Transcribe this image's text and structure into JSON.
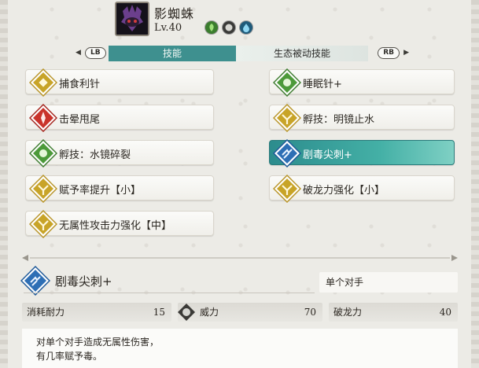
{
  "monster": {
    "name": "影蜘蛛",
    "level": "Lv.40",
    "elements": [
      "grass-element-icon",
      "neutral-element-icon",
      "water-element-icon"
    ]
  },
  "tabs": {
    "lb": "LB",
    "rb": "RB",
    "skills": "技能",
    "eco": "生态被动技能"
  },
  "skills": [
    {
      "label": "捕食利针",
      "icon": "grass-skill-icon",
      "color": "yellow"
    },
    {
      "label": "睡眠针+",
      "icon": "grass-skill-icon",
      "color": "green"
    },
    {
      "label": "击晕甩尾",
      "icon": "fire-skill-icon",
      "color": "red"
    },
    {
      "label": "孵技：明镜止水",
      "icon": "buff-skill-icon",
      "color": "yellow"
    },
    {
      "label": "孵技：水镜碎裂",
      "icon": "grass-skill-icon",
      "color": "green"
    },
    {
      "label": "剧毒尖刺+",
      "icon": "rush-skill-icon",
      "color": "blue"
    },
    {
      "label": "赋予率提升【小】",
      "icon": "buff-skill-icon",
      "color": "yellow"
    },
    {
      "label": "破龙力强化【小】",
      "icon": "buff-skill-icon",
      "color": "yellow"
    },
    {
      "label": "无属性攻击力强化【中】",
      "icon": "buff-skill-icon",
      "color": "yellow"
    }
  ],
  "detail": {
    "name": "剧毒尖刺+",
    "target": "单个对手",
    "stamina_label": "消耗耐力",
    "stamina_value": "15",
    "power_label": "威力",
    "power_value": "70",
    "dragon_label": "破龙力",
    "dragon_value": "40",
    "desc_line1": "对单个对手造成无属性伤害，",
    "desc_line2": "有几率赋予毒。"
  },
  "colors": {
    "accent": "#3e908f",
    "yellow": "#c8a428",
    "green": "#4c9a3a",
    "red": "#c9332b",
    "blue": "#2e6fb5"
  }
}
